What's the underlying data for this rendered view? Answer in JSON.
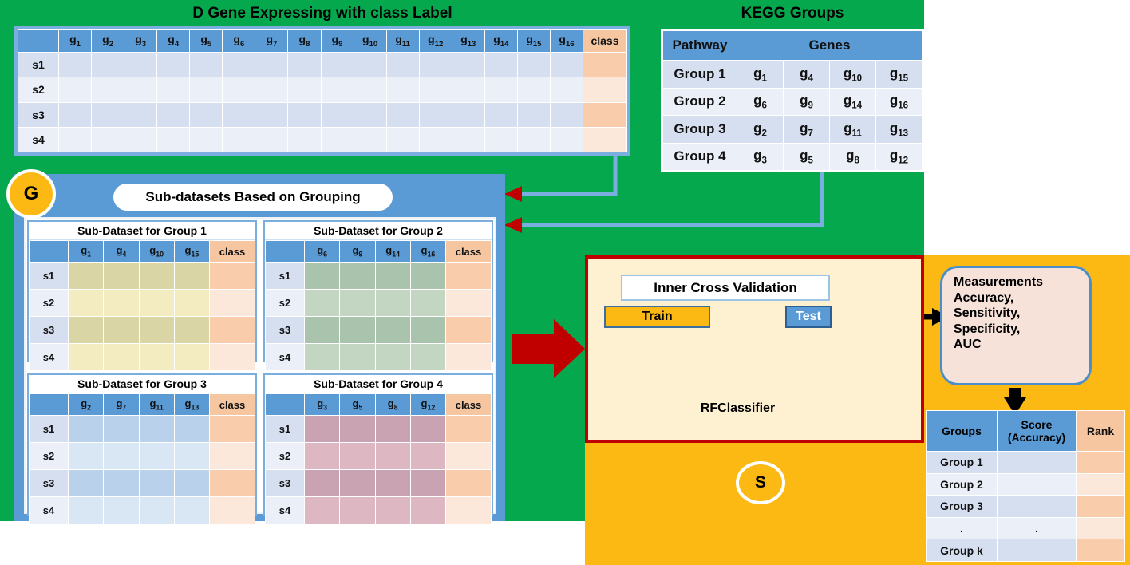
{
  "titles": {
    "dgene": "D Gene Expressing with class Label",
    "kegg": "KEGG Groups",
    "subdatasets": "Sub-datasets Based on Grouping"
  },
  "badges": {
    "grouping": "G",
    "scoring": "S"
  },
  "dgene_table": {
    "corner": "",
    "gene_headers": [
      "g1",
      "g2",
      "g3",
      "g4",
      "g5",
      "g6",
      "g7",
      "g8",
      "g9",
      "g10",
      "g11",
      "g12",
      "g13",
      "g14",
      "g15",
      "g16"
    ],
    "class_header": "class",
    "rows": [
      "s1",
      "s2",
      "s3",
      "s4"
    ]
  },
  "kegg_table": {
    "headers": {
      "pathway": "Pathway",
      "genes": "Genes"
    },
    "rows": [
      {
        "group": "Group 1",
        "genes": [
          "g1",
          "g4",
          "g10",
          "g15"
        ]
      },
      {
        "group": "Group 2",
        "genes": [
          "g6",
          "g9",
          "g14",
          "g16"
        ]
      },
      {
        "group": "Group 3",
        "genes": [
          "g2",
          "g7",
          "g11",
          "g13"
        ]
      },
      {
        "group": "Group 4",
        "genes": [
          "g3",
          "g5",
          "g8",
          "g12"
        ]
      }
    ]
  },
  "sub_datasets": [
    {
      "caption": "Sub-Dataset for Group 1",
      "gene_headers": [
        "g1",
        "g4",
        "g10",
        "g15"
      ],
      "class_header": "class",
      "rows": [
        "s1",
        "s2",
        "s3",
        "s4"
      ],
      "tint": "Y"
    },
    {
      "caption": "Sub-Dataset for Group 2",
      "gene_headers": [
        "g6",
        "g9",
        "g14",
        "g16"
      ],
      "class_header": "class",
      "rows": [
        "s1",
        "s2",
        "s3",
        "s4"
      ],
      "tint": "G"
    },
    {
      "caption": "Sub-Dataset for Group 3",
      "gene_headers": [
        "g2",
        "g7",
        "g11",
        "g13"
      ],
      "class_header": "class",
      "rows": [
        "s1",
        "s2",
        "s3",
        "s4"
      ],
      "tint": "B"
    },
    {
      "caption": "Sub-Dataset for Group 4",
      "gene_headers": [
        "g3",
        "g5",
        "g8",
        "g12"
      ],
      "class_header": "class",
      "rows": [
        "s1",
        "s2",
        "s3",
        "s4"
      ],
      "tint": "P"
    }
  ],
  "inner_cv": {
    "title": "Inner Cross Validation",
    "train_label": "Train",
    "test_label": "Test",
    "classifier_label": "RF Classifier",
    "classifier_line1": "RF",
    "classifier_line2": "Classifier"
  },
  "measurements": {
    "line1": "Measurements",
    "line2": "Accuracy,",
    "line3": "Sensitivity,",
    "line4": "Specificity,",
    "line5": "AUC"
  },
  "score_table": {
    "headers": {
      "groups": "Groups",
      "score_l1": "Score",
      "score_l2": "(Accuracy)",
      "rank": "Rank"
    },
    "rows": [
      "Group 1",
      "Group 2",
      "Group 3",
      ".",
      "Group k"
    ],
    "score_values": [
      "",
      "",
      "",
      ".",
      ""
    ],
    "rank_values": [
      "",
      "",
      "",
      "",
      ""
    ]
  },
  "colors": {
    "green_panel": "#06a84e",
    "orange_panel": "#fdb913",
    "blue_header": "#5b9bd5",
    "class_peach": "#f6c6a0",
    "red_border": "#c00000",
    "red_arrow": "#c00000",
    "connector_blue": "#7aaede",
    "rf_purple": "#d9a0cd",
    "cream": "#fdf1d2"
  }
}
